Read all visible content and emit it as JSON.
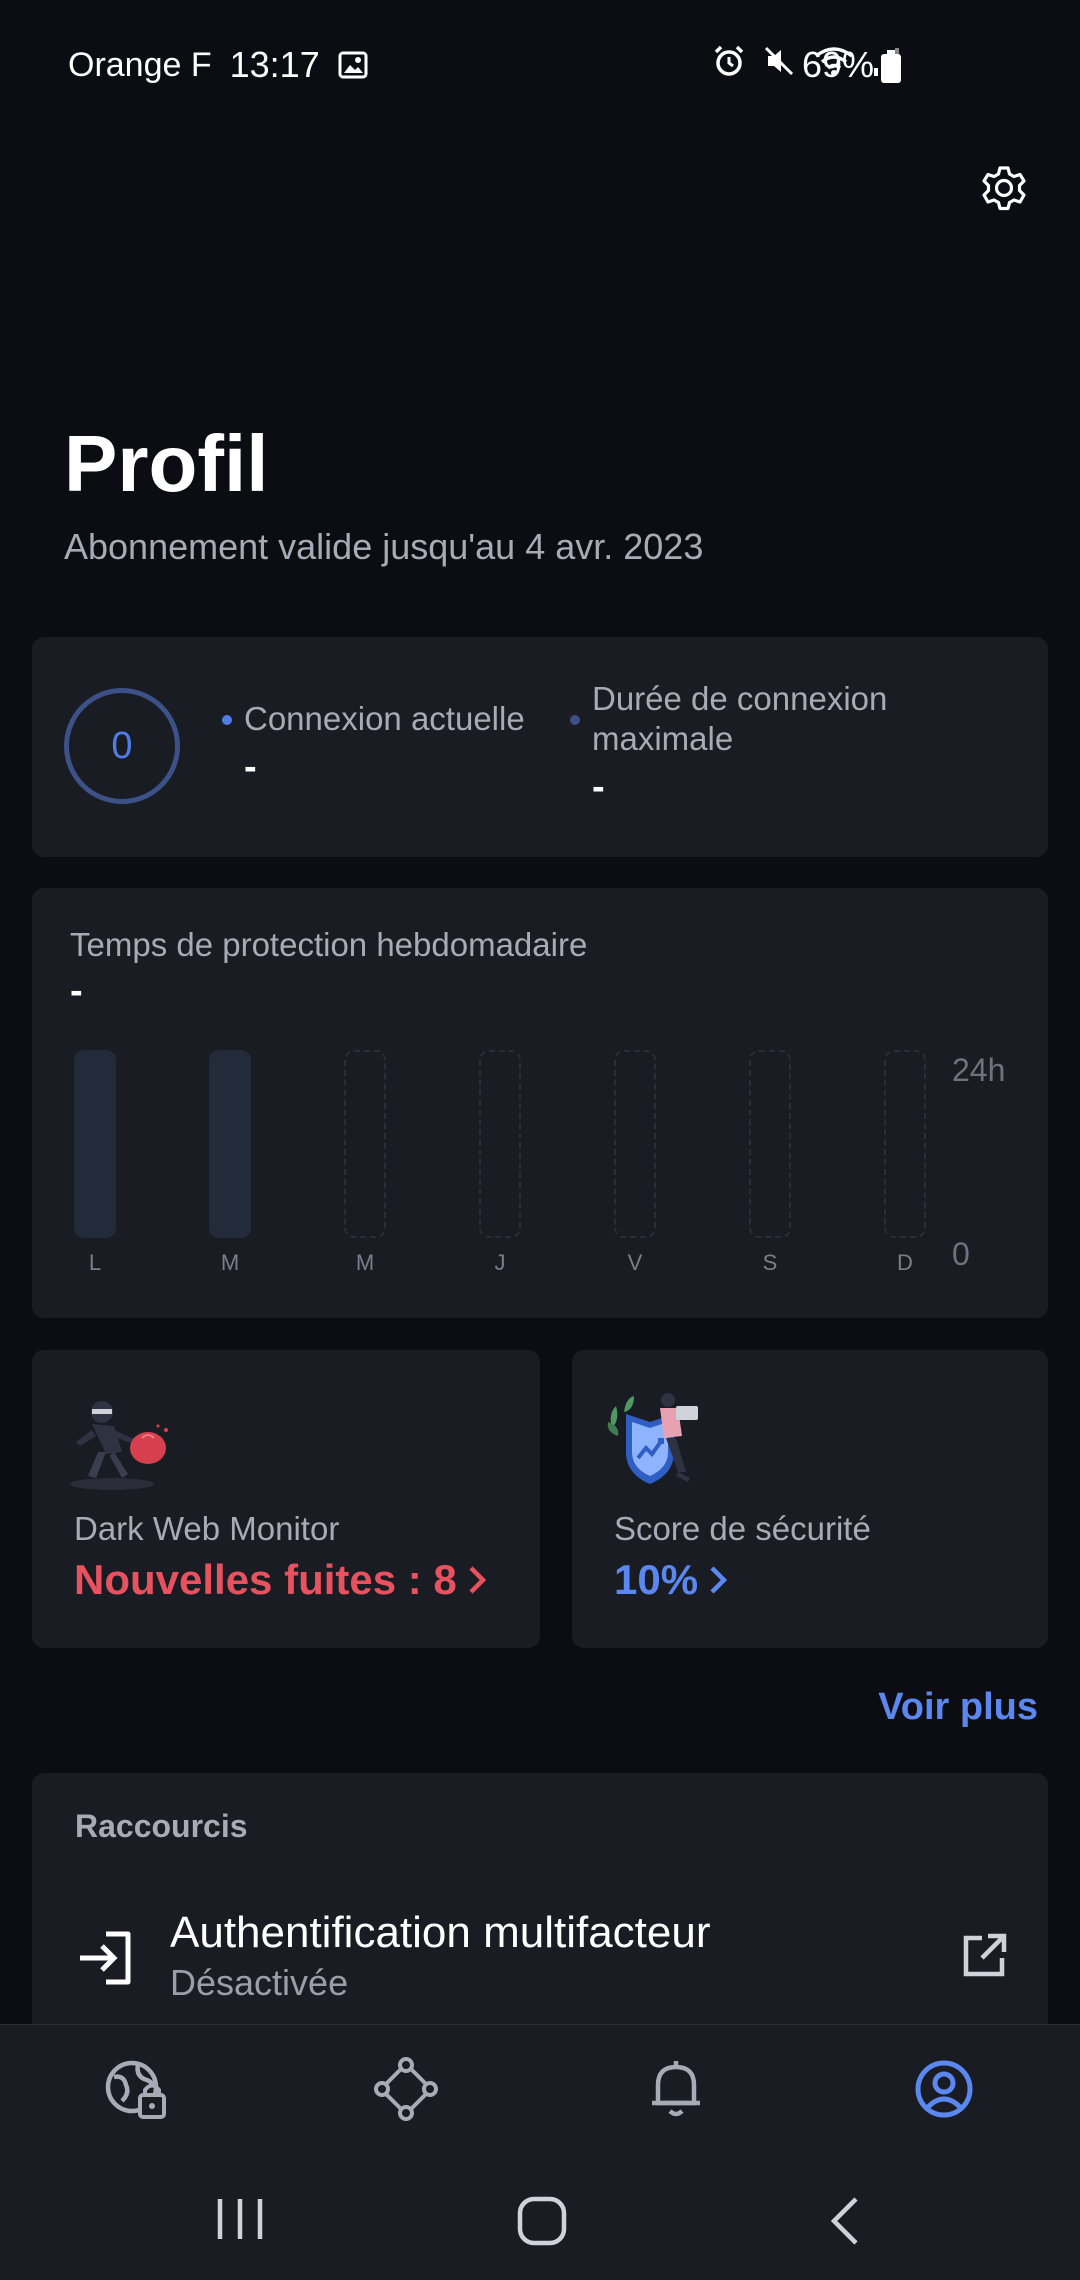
{
  "status_bar": {
    "carrier": "Orange F",
    "time": "13:17",
    "battery": "69%"
  },
  "profile": {
    "title": "Profil",
    "subtitle": "Abonnement valide jusqu'au 4 avr. 2023"
  },
  "connection": {
    "count": "0",
    "current_label": "Connexion actuelle",
    "current_value": "-",
    "max_label_line1": "Durée de connexion",
    "max_label_line2": "maximale",
    "max_value": "-"
  },
  "weekly": {
    "title": "Temps de protection hebdomadaire",
    "value": "-",
    "axis_top": "24h",
    "axis_bottom": "0",
    "days": [
      "L",
      "M",
      "M",
      "J",
      "V",
      "S",
      "D"
    ]
  },
  "dark_web": {
    "label": "Dark Web Monitor",
    "value": "Nouvelles fuites : 8"
  },
  "security_score": {
    "label": "Score de sécurité",
    "value": "10%"
  },
  "voir_plus": "Voir plus",
  "shortcuts": {
    "title": "Raccourcis",
    "mfa_title": "Authentification multifacteur",
    "mfa_status": "Désactivée"
  },
  "colors": {
    "accent_blue": "#5a87f0",
    "alert_red": "#e8525f",
    "background": "#0b0d12",
    "card": "#1a1c24"
  }
}
